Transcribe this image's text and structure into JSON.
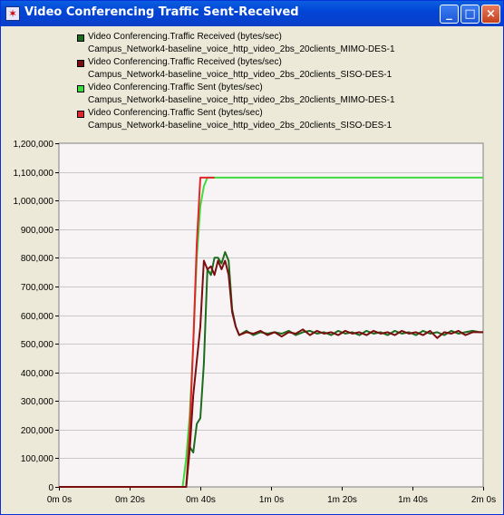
{
  "window": {
    "title": "Video Conferencing Traffic Sent-Received",
    "minimize_label": "_",
    "maximize_label": "□",
    "close_label": "×"
  },
  "legend": [
    {
      "name": "Video Conferencing.Traffic Received (bytes/sec)",
      "scenario": "Campus_Network4-baseline_voice_http_video_2bs_20clients_MIMO-DES-1",
      "color": "#1e6b1e"
    },
    {
      "name": "Video Conferencing.Traffic Received (bytes/sec)",
      "scenario": "Campus_Network4-baseline_voice_http_video_2bs_20clients_SISO-DES-1",
      "color": "#7a0e0e"
    },
    {
      "name": "Video Conferencing.Traffic Sent (bytes/sec)",
      "scenario": "Campus_Network4-baseline_voice_http_video_2bs_20clients_MIMO-DES-1",
      "color": "#3ddc3d"
    },
    {
      "name": "Video Conferencing.Traffic Sent (bytes/sec)",
      "scenario": "Campus_Network4-baseline_voice_http_video_2bs_20clients_SISO-DES-1",
      "color": "#e2262b"
    }
  ],
  "chart_data": {
    "type": "line",
    "xlim": [
      0,
      120
    ],
    "ylim": [
      0,
      1200000
    ],
    "grid": true,
    "x_tick_values": [
      0,
      20,
      40,
      60,
      80,
      100,
      120
    ],
    "x_tick_labels": [
      "0m 0s",
      "0m 20s",
      "0m 40s",
      "1m 0s",
      "1m 20s",
      "1m 40s",
      "2m 0s"
    ],
    "y_tick_values": [
      0,
      100000,
      200000,
      300000,
      400000,
      500000,
      600000,
      700000,
      800000,
      900000,
      1000000,
      1100000,
      1200000
    ],
    "y_tick_labels": [
      "0",
      "100,000",
      "200,000",
      "300,000",
      "400,000",
      "500,000",
      "600,000",
      "700,000",
      "800,000",
      "900,000",
      "1,000,000",
      "1,100,000",
      "1,200,000"
    ],
    "series": [
      {
        "name": "Video Conferencing.Traffic Sent (bytes/sec)",
        "color": "#3ddc3d",
        "points": [
          [
            0,
            0
          ],
          [
            35,
            0
          ],
          [
            36,
            100000
          ],
          [
            37,
            250000
          ],
          [
            38,
            500000
          ],
          [
            39,
            800000
          ],
          [
            40,
            980000
          ],
          [
            41,
            1050000
          ],
          [
            42,
            1080000
          ],
          [
            120,
            1080000
          ]
        ]
      },
      {
        "name": "Video Conferencing.Traffic Sent (bytes/sec)",
        "color": "#e2262b",
        "points": [
          [
            0,
            0
          ],
          [
            36,
            0
          ],
          [
            37,
            200000
          ],
          [
            38,
            500000
          ],
          [
            39,
            850000
          ],
          [
            40,
            1080000
          ],
          [
            44,
            1080000
          ]
        ]
      },
      {
        "name": "Video Conferencing.Traffic Received (bytes/sec)",
        "color": "#1e6b1e",
        "points": [
          [
            0,
            0
          ],
          [
            36,
            0
          ],
          [
            37,
            140000
          ],
          [
            38,
            120000
          ],
          [
            39,
            220000
          ],
          [
            40,
            240000
          ],
          [
            41,
            430000
          ],
          [
            42,
            760000
          ],
          [
            43,
            740000
          ],
          [
            44,
            800000
          ],
          [
            45,
            800000
          ],
          [
            46,
            780000
          ],
          [
            47,
            820000
          ],
          [
            48,
            790000
          ],
          [
            49,
            620000
          ],
          [
            50,
            560000
          ],
          [
            51,
            530000
          ],
          [
            53,
            545000
          ],
          [
            55,
            530000
          ],
          [
            57,
            540000
          ],
          [
            59,
            535000
          ],
          [
            61,
            540000
          ],
          [
            63,
            535000
          ],
          [
            65,
            545000
          ],
          [
            67,
            530000
          ],
          [
            69,
            540000
          ],
          [
            71,
            545000
          ],
          [
            73,
            535000
          ],
          [
            75,
            540000
          ],
          [
            77,
            530000
          ],
          [
            79,
            545000
          ],
          [
            81,
            535000
          ],
          [
            83,
            540000
          ],
          [
            85,
            530000
          ],
          [
            87,
            545000
          ],
          [
            89,
            535000
          ],
          [
            91,
            540000
          ],
          [
            93,
            530000
          ],
          [
            95,
            545000
          ],
          [
            97,
            535000
          ],
          [
            99,
            540000
          ],
          [
            101,
            530000
          ],
          [
            103,
            545000
          ],
          [
            105,
            535000
          ],
          [
            107,
            540000
          ],
          [
            109,
            530000
          ],
          [
            111,
            545000
          ],
          [
            113,
            535000
          ],
          [
            115,
            540000
          ],
          [
            117,
            545000
          ],
          [
            119,
            540000
          ],
          [
            120,
            540000
          ]
        ]
      },
      {
        "name": "Video Conferencing.Traffic Received (bytes/sec)",
        "color": "#7a0e0e",
        "points": [
          [
            0,
            0
          ],
          [
            36,
            0
          ],
          [
            37,
            130000
          ],
          [
            38,
            320000
          ],
          [
            39,
            440000
          ],
          [
            40,
            560000
          ],
          [
            41,
            790000
          ],
          [
            42,
            760000
          ],
          [
            43,
            770000
          ],
          [
            44,
            740000
          ],
          [
            45,
            790000
          ],
          [
            46,
            760000
          ],
          [
            47,
            790000
          ],
          [
            48,
            740000
          ],
          [
            49,
            610000
          ],
          [
            50,
            560000
          ],
          [
            51,
            530000
          ],
          [
            53,
            540000
          ],
          [
            55,
            535000
          ],
          [
            57,
            545000
          ],
          [
            59,
            530000
          ],
          [
            61,
            540000
          ],
          [
            63,
            525000
          ],
          [
            65,
            540000
          ],
          [
            67,
            535000
          ],
          [
            69,
            550000
          ],
          [
            71,
            530000
          ],
          [
            73,
            545000
          ],
          [
            75,
            535000
          ],
          [
            77,
            540000
          ],
          [
            79,
            530000
          ],
          [
            81,
            545000
          ],
          [
            83,
            535000
          ],
          [
            85,
            540000
          ],
          [
            87,
            530000
          ],
          [
            89,
            545000
          ],
          [
            91,
            535000
          ],
          [
            93,
            540000
          ],
          [
            95,
            530000
          ],
          [
            97,
            545000
          ],
          [
            99,
            535000
          ],
          [
            101,
            540000
          ],
          [
            103,
            530000
          ],
          [
            105,
            545000
          ],
          [
            107,
            520000
          ],
          [
            109,
            540000
          ],
          [
            111,
            535000
          ],
          [
            113,
            545000
          ],
          [
            115,
            530000
          ],
          [
            117,
            540000
          ],
          [
            119,
            540000
          ],
          [
            120,
            540000
          ]
        ]
      }
    ]
  }
}
